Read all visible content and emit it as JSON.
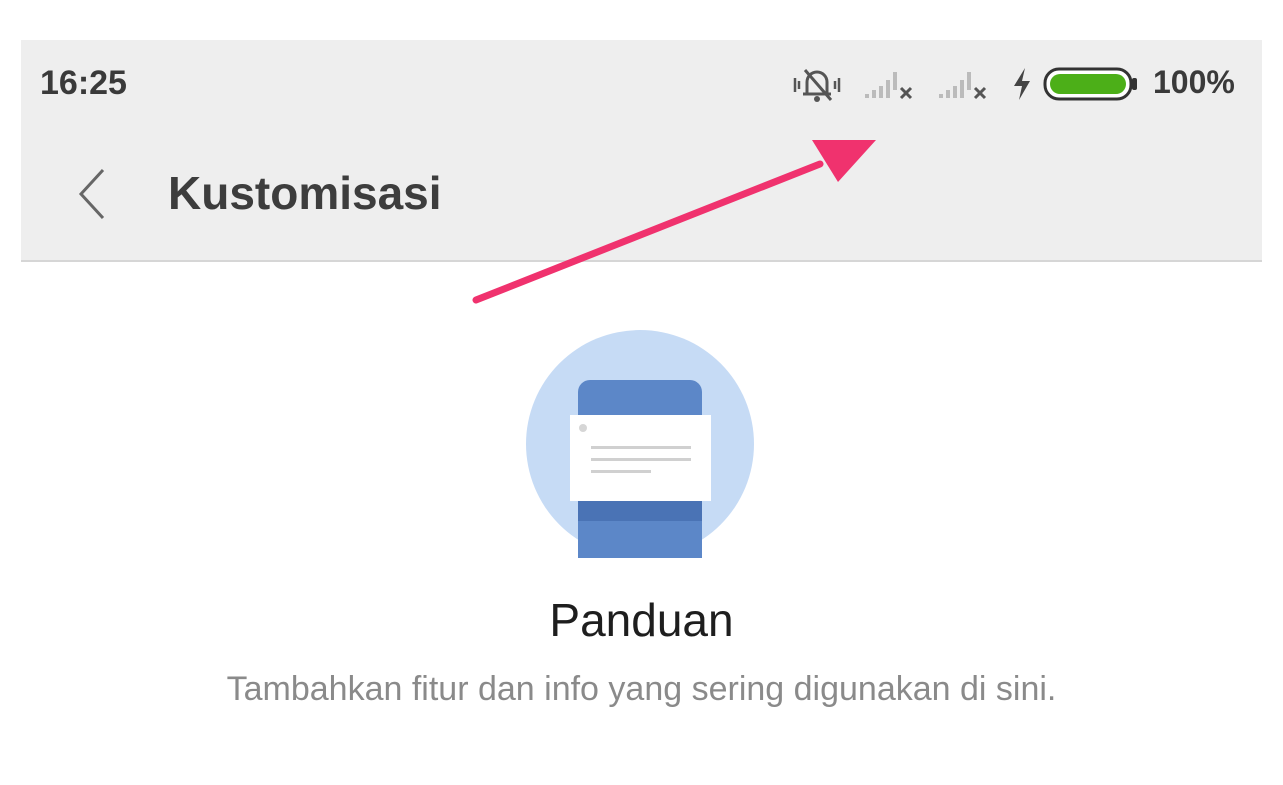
{
  "status_bar": {
    "time": "16:25",
    "battery_percent": "100%",
    "icons": [
      "vibrate-off-icon",
      "no-signal-sim1-icon",
      "no-signal-sim2-icon",
      "charging-bolt-icon",
      "battery-icon"
    ],
    "battery_color": "#4caf18"
  },
  "app_bar": {
    "back_icon": "chevron-left-icon",
    "title": "Kustomisasi"
  },
  "content": {
    "illustration_icon": "guide-card-icon",
    "heading": "Panduan",
    "description": "Tambahkan fitur dan info yang sering digunakan di sini."
  },
  "colors": {
    "bar_background": "#eeeeee",
    "annotation_arrow": "#f0326e",
    "illustration_circle": "#c6dbf5",
    "illustration_card": "#5c87c8"
  }
}
